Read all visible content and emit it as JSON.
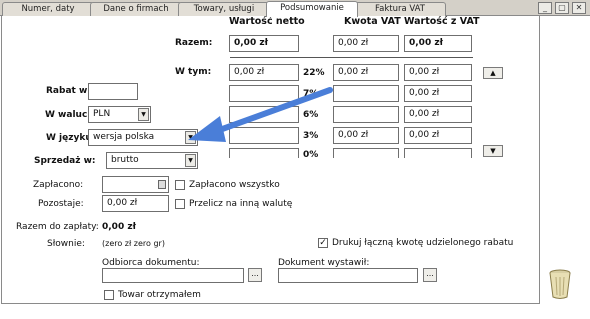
{
  "tabs": [
    {
      "label": "Numer, daty"
    },
    {
      "label": "Dane o firmach"
    },
    {
      "label": "Towary, usługi"
    },
    {
      "label": "Podsumowanie"
    },
    {
      "label": "Faktura VAT"
    }
  ],
  "active_tab": "Podsumowanie",
  "window_buttons": {
    "minimize": "_",
    "restore": "▢",
    "close": "✕"
  },
  "columns": {
    "netto": "Wartość netto",
    "vat": "Kwota VAT",
    "brutto": "Wartość z VAT"
  },
  "razem": {
    "label": "Razem:",
    "netto": "0,00 zł",
    "vat": "0,00 zł",
    "brutto": "0,00 zł"
  },
  "w_tym_label": "W tym:",
  "vat_rows": [
    {
      "netto": "0,00 zł",
      "rate": "22%",
      "vat": "0,00 zł",
      "brutto": "0,00 zł"
    },
    {
      "netto": "",
      "rate": "7%",
      "vat": "",
      "brutto": "0,00 zł"
    },
    {
      "netto": "",
      "rate": "6%",
      "vat": "",
      "brutto": "0,00 zł"
    },
    {
      "netto": "",
      "rate": "3%",
      "vat": "0,00 zł",
      "brutto": "0,00 zł"
    },
    {
      "netto": "",
      "rate": "0%",
      "vat": "",
      "brutto": ""
    }
  ],
  "rabat": {
    "label": "Rabat w %:",
    "value": ""
  },
  "waluta": {
    "label": "W walucie:",
    "value": "PLN"
  },
  "jezyk": {
    "label": "W języku:",
    "value": "wersja polska"
  },
  "sprzedaz": {
    "label": "Sprzedaż w:",
    "value": "brutto"
  },
  "zaplacono": {
    "label": "Zapłacono:",
    "value": "",
    "check_label": "Zapłacono wszystko"
  },
  "pozostaje": {
    "label": "Pozostaje:",
    "value": "0,00 zł",
    "check_label": "Przelicz na inną walutę"
  },
  "razem_do_zaplaty": {
    "label": "Razem do zapłaty:",
    "value": "0,00 zł"
  },
  "slownie": {
    "label": "Słownie:",
    "value": "(zero zł zero gr)"
  },
  "drukuj": {
    "label": "Drukuj łączną kwotę udzielonego rabatu",
    "checked": true
  },
  "odbiorca": {
    "label": "Odbiorca dokumentu:",
    "value": ""
  },
  "wystawil": {
    "label": "Dokument wystawił:",
    "value": ""
  },
  "towar": {
    "label": "Towar otrzymałem",
    "checked": false
  },
  "colors": {
    "arrow": "#4a7ed8",
    "tab_bg": "#d4d0c8"
  }
}
